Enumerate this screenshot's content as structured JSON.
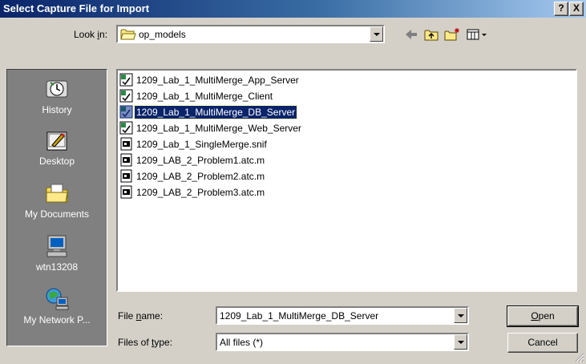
{
  "window": {
    "title": "Select Capture File for Import",
    "help_label": "?",
    "close_label": "X"
  },
  "lookin": {
    "label_pre": "Look ",
    "label_key": "i",
    "label_post": "n:",
    "value": "op_models"
  },
  "places": [
    {
      "label": "History",
      "icon": "history-icon"
    },
    {
      "label": "Desktop",
      "icon": "desktop-icon"
    },
    {
      "label": "My Documents",
      "icon": "my-documents-icon"
    },
    {
      "label": "wtn13208",
      "icon": "computer-icon"
    },
    {
      "label": "My Network P...",
      "icon": "network-places-icon"
    }
  ],
  "files": [
    {
      "name": "1209_Lab_1_MultiMerge_App_Server",
      "icon": "model-file-icon",
      "selected": false
    },
    {
      "name": "1209_Lab_1_MultiMerge_Client",
      "icon": "model-file-icon",
      "selected": false
    },
    {
      "name": "1209_Lab_1_MultiMerge_DB_Server",
      "icon": "model-file-icon",
      "selected": true
    },
    {
      "name": "1209_Lab_1_MultiMerge_Web_Server",
      "icon": "model-file-icon",
      "selected": false
    },
    {
      "name": "1209_Lab_1_SingleMerge.snif",
      "icon": "document-file-icon",
      "selected": false
    },
    {
      "name": "1209_LAB_2_Problem1.atc.m",
      "icon": "document-file-icon",
      "selected": false
    },
    {
      "name": "1209_LAB_2_Problem2.atc.m",
      "icon": "document-file-icon",
      "selected": false
    },
    {
      "name": "1209_LAB_2_Problem3.atc.m",
      "icon": "document-file-icon",
      "selected": false
    }
  ],
  "filename": {
    "label_pre": "File ",
    "label_key": "n",
    "label_post": "ame:",
    "value": "1209_Lab_1_MultiMerge_DB_Server"
  },
  "filetype": {
    "label_pre": "Files of ",
    "label_key": "t",
    "label_post": "ype:",
    "value": "All files (*)"
  },
  "buttons": {
    "open_key": "O",
    "open_rest": "pen",
    "cancel": "Cancel"
  },
  "colors": {
    "title_active": "#0a246a",
    "selection": "#0a246a",
    "face": "#d4d0c8"
  }
}
